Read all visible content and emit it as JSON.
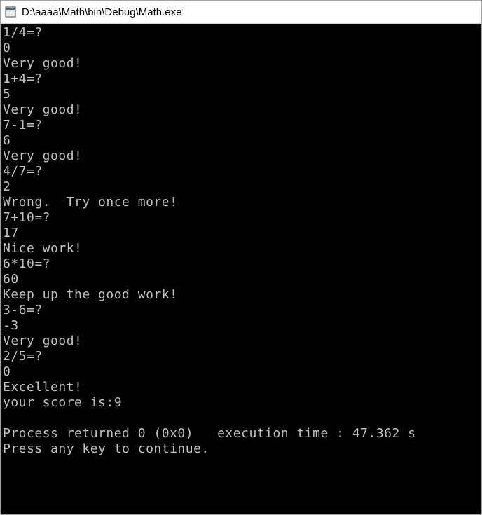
{
  "window": {
    "title": "D:\\aaaa\\Math\\bin\\Debug\\Math.exe"
  },
  "console": {
    "lines": [
      "1/4=?",
      "0",
      "Very good!",
      "1+4=?",
      "5",
      "Very good!",
      "7-1=?",
      "6",
      "Very good!",
      "4/7=?",
      "2",
      "Wrong.  Try once more!",
      "7+10=?",
      "17",
      "Nice work!",
      "6*10=?",
      "60",
      "Keep up the good work!",
      "3-6=?",
      "-3",
      "Very good!",
      "2/5=?",
      "0",
      "Excellent!",
      "your score is:9",
      "",
      "Process returned 0 (0x0)   execution time : 47.362 s",
      "Press any key to continue.",
      ""
    ]
  }
}
